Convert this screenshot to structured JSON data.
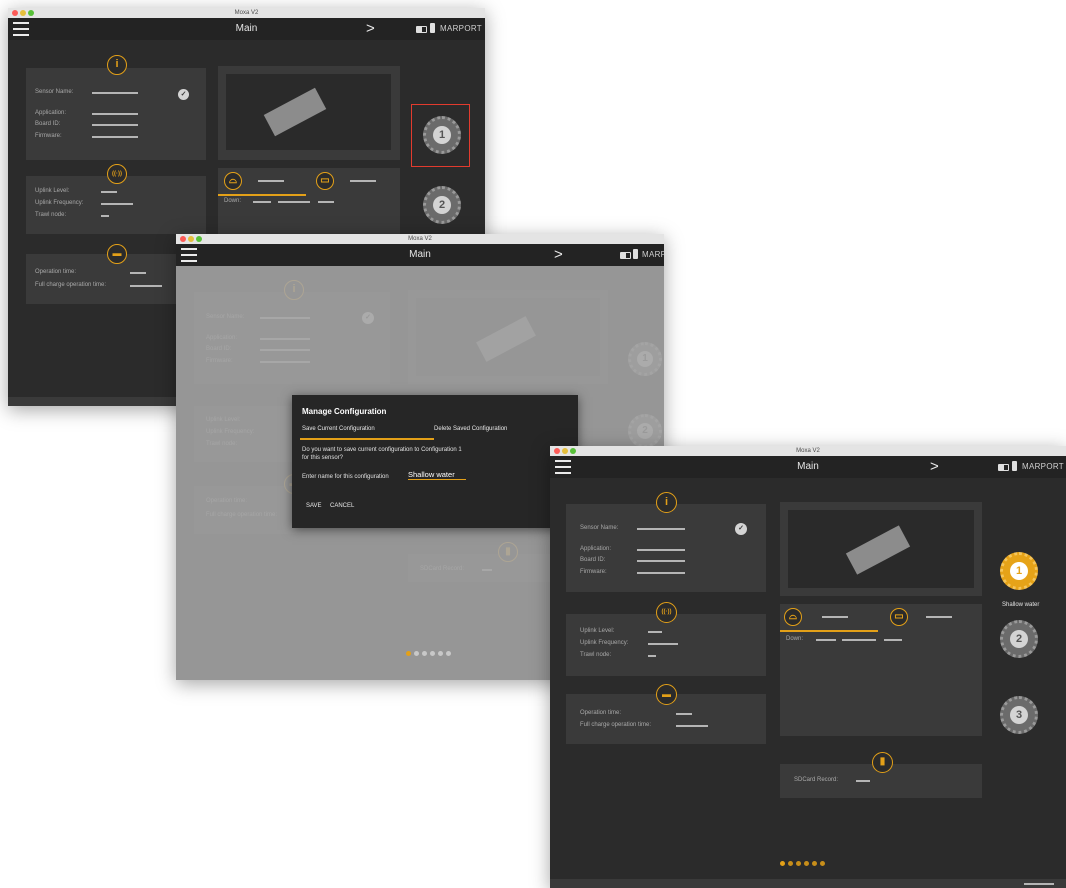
{
  "window": {
    "title": "Moxa V2"
  },
  "appbar": {
    "title": "Main",
    "next": ">",
    "brand": "MARPORT"
  },
  "info": {
    "sensor_name": "Sensor Name:",
    "application": "Application:",
    "board_id": "Board ID:",
    "firmware": "Firmware:",
    "check": "✓"
  },
  "uplink": {
    "level": "Uplink Level:",
    "frequency": "Uplink Frequency:",
    "trawl_mode": "Trawl node:"
  },
  "battery": {
    "operation_time": "Operation time:",
    "full_charge": "Full charge operation time:"
  },
  "sonar": {
    "down": "Down:"
  },
  "sdcard": {
    "record": "SDCard Record:"
  },
  "badges": {
    "info": "i",
    "uplink": "((·))",
    "battery": "▬",
    "sd": "▮",
    "sonar": "⌓",
    "sonar2": "▭"
  },
  "configs": {
    "one": "1",
    "two": "2",
    "three": "3",
    "saved_label": "Shallow water"
  },
  "dialog": {
    "title": "Manage Configuration",
    "tab_save": "Save Current Configuration",
    "tab_delete": "Delete Saved Configuration",
    "question": "Do you want to save current configuration to Configuration 1 for this sensor?",
    "name_prompt": "Enter name for this configuration",
    "name_value": "Shallow water",
    "save": "SAVE",
    "cancel": "CANCEL"
  },
  "colors": {
    "accent": "#e3a018",
    "background": "#2b2b2b",
    "panel": "#3a3a3a",
    "highlight": "#e23b2e"
  },
  "page_dots": {
    "total": 6,
    "active": 1
  }
}
